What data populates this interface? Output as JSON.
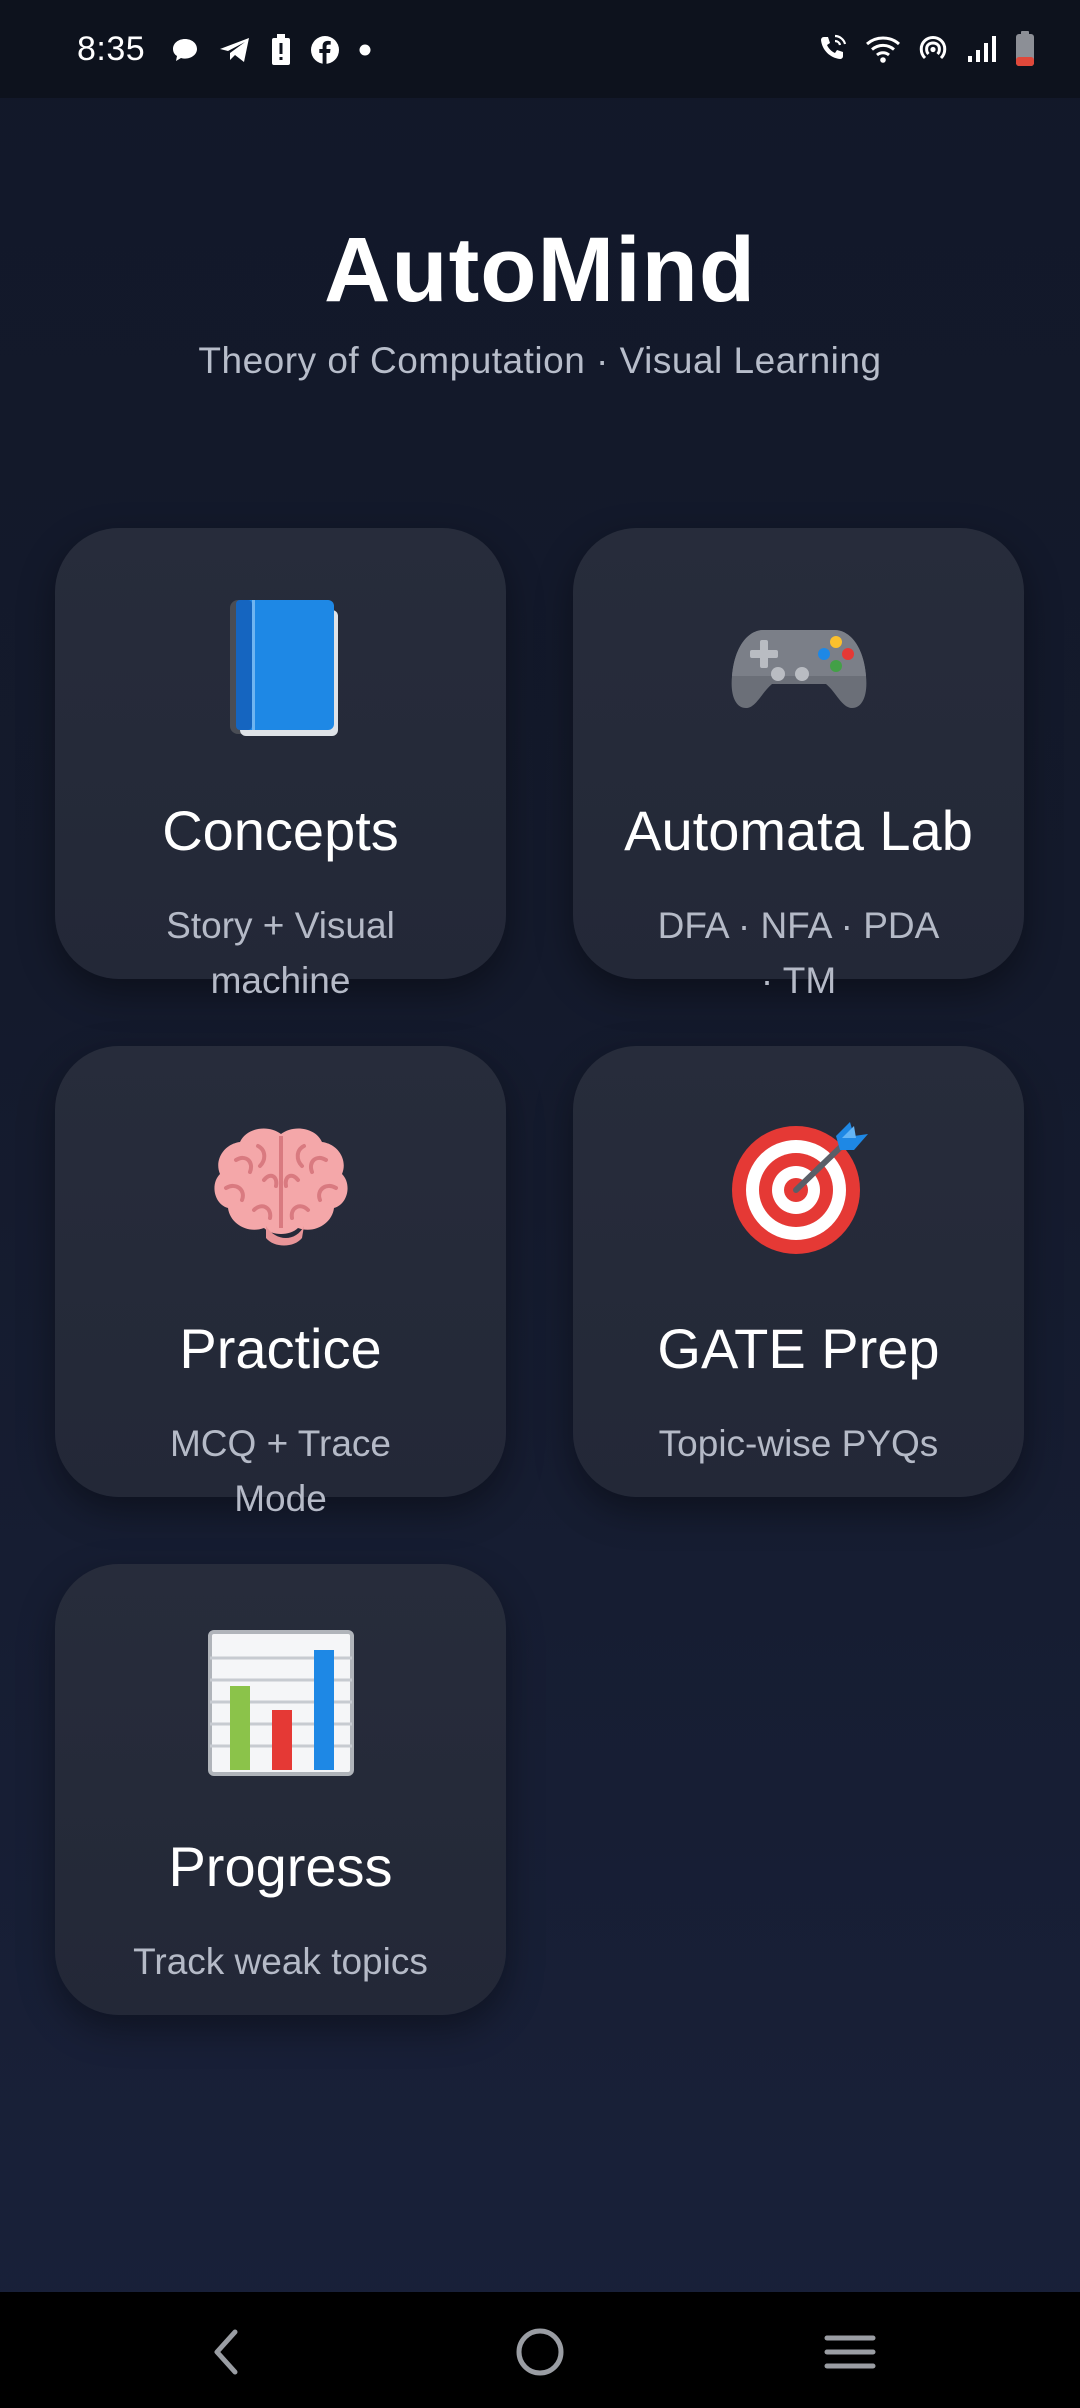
{
  "status_bar": {
    "time": "8:35",
    "left_icons": [
      "chat-bubble-icon",
      "telegram-icon",
      "battery-alert-icon",
      "facebook-icon",
      "dot-icon"
    ],
    "right_icons": [
      "wifi-calling-icon",
      "wifi-icon",
      "hotspot-icon",
      "signal-icon",
      "battery-low-icon"
    ]
  },
  "header": {
    "title": "AutoMind",
    "subtitle": "Theory of Computation · Visual Learning"
  },
  "cards": [
    {
      "id": "concepts",
      "icon": "book-icon",
      "title": "Concepts",
      "description": "Story + Visual machine"
    },
    {
      "id": "automata-lab",
      "icon": "game-controller-icon",
      "title": "Automata Lab",
      "description": "DFA · NFA · PDA · TM"
    },
    {
      "id": "practice",
      "icon": "brain-icon",
      "title": "Practice",
      "description": "MCQ + Trace Mode"
    },
    {
      "id": "gate-prep",
      "icon": "target-icon",
      "title": "GATE Prep",
      "description": "Topic-wise PYQs"
    },
    {
      "id": "progress",
      "icon": "bar-chart-icon",
      "title": "Progress",
      "description": "Track weak topics"
    }
  ],
  "nav_bar": {
    "buttons": [
      "back-icon",
      "home-icon",
      "recents-icon"
    ]
  },
  "colors": {
    "background": "#141a2c",
    "card": "#262b3a",
    "title_text": "#ffffff",
    "secondary_text": "#b5bac7"
  }
}
